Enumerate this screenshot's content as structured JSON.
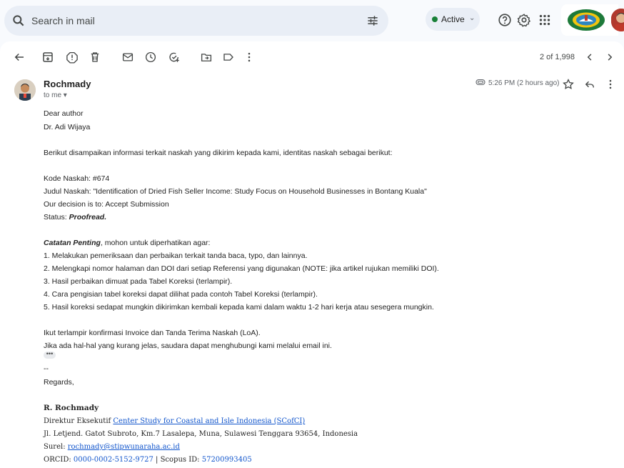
{
  "search": {
    "placeholder": "Search in mail"
  },
  "status": {
    "label": "Active",
    "color": "#188038"
  },
  "toolbar": {
    "pager": "2 of 1,998"
  },
  "message": {
    "sender": "Rochmady",
    "recipient": "to me",
    "time": "5:26 PM (2 hours ago)",
    "lines": [
      "Dear author",
      "Dr. Adi Wijaya",
      "Berikut disampaikan informasi terkait naskah yang dikirim kepada kami, identitas naskah sebagai berikut:",
      "Kode Naskah: #674",
      "Judul Naskah: \"Identification of Dried Fish Seller Income: Study Focus on Household Businesses in Bontang Kuala\"",
      "Our decision is to: Accept Submission",
      "Status: ",
      "Proofread.",
      "Catatan Penting",
      ", mohon untuk diperhatikan agar:",
      "1. Melakukan pemeriksaan dan perbaikan terkait tanda baca, typo, dan lainnya.",
      "2. Melengkapi nomor halaman dan DOI dari setiap Referensi yang digunakan (NOTE: jika artikel rujukan memiliki DOI).",
      "3. Hasil perbaikan dimuat pada Tabel Koreksi (terlampir).",
      "4. Cara pengisian tabel koreksi dapat dilihat pada contoh Tabel Koreksi (terlampir).",
      "5. Hasil koreksi sedapat mungkin dikirimkan kembali kepada kami dalam waktu 1-2 hari kerja atau sesegera mungkin.",
      "Ikut terlampir konfirmasi Invoice dan Tanda Terima Naskah (LoA).",
      "Jika ada hal-hal yang kurang jelas, saudara dapat menghubungi kami melalui email ini.",
      "--",
      "Regards,"
    ],
    "more": "•••"
  },
  "signature": {
    "name": "R. Rochmady",
    "title_prefix": "Direktur Eksekutif ",
    "org_link": "Center Study for Coastal and Isle Indonesia (SCofCI)",
    "address": "Jl. Letjend. Gatot Subroto, Km.7 Lasalepa, Muna, Sulawesi Tenggara 93654, Indonesia",
    "email_prefix": "Surel: ",
    "email": "rochmady@stipwunaraha.ac.id",
    "orcid_prefix": "ORCID: ",
    "orcid": "0000-0002-5152-9727",
    "scopus_prefix": " | Scopus ID: ",
    "scopus": "57200993405"
  },
  "icons": [
    "search-icon",
    "filter-icon",
    "help-icon",
    "settings-icon",
    "apps-icon",
    "back-icon",
    "archive-icon",
    "report-spam-icon",
    "delete-icon",
    "mark-unread-icon",
    "snooze-icon",
    "add-task-icon",
    "move-to-icon",
    "label-icon",
    "more-icon",
    "prev-icon",
    "next-icon",
    "attachment-icon",
    "star-icon",
    "reply-icon",
    "more-vert-icon"
  ]
}
